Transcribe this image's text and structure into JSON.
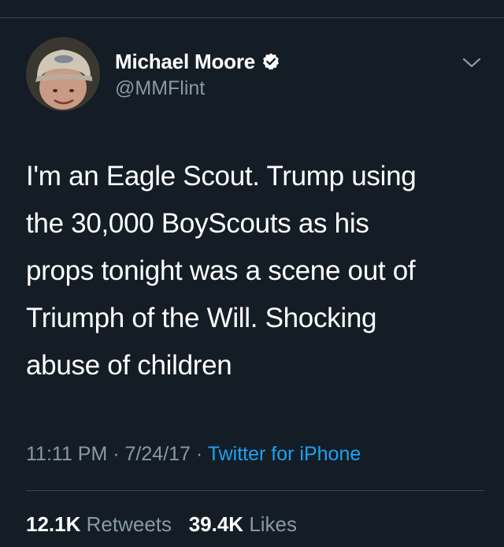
{
  "author": {
    "display_name": "Michael Moore",
    "handle": "@MMFlint",
    "verified": true
  },
  "tweet": {
    "text": "I'm an Eagle Scout. Trump using\nthe 30,000 BoyScouts as his\nprops tonight was a scene out of\nTriumph of the Will. Shocking\nabuse of children",
    "time": "11:11 PM",
    "date": "7/24/17",
    "source": "Twitter for iPhone",
    "separator": "·"
  },
  "stats": {
    "retweets_count": "12.1K",
    "retweets_label": "Retweets",
    "likes_count": "39.4K",
    "likes_label": "Likes"
  },
  "icons": {
    "verified": "verified-badge-icon",
    "menu": "chevron-down-icon"
  },
  "colors": {
    "background": "#141d26",
    "text_primary": "#ffffff",
    "text_secondary": "#8899a6",
    "link": "#1da1f2",
    "divider": "#38444d"
  }
}
